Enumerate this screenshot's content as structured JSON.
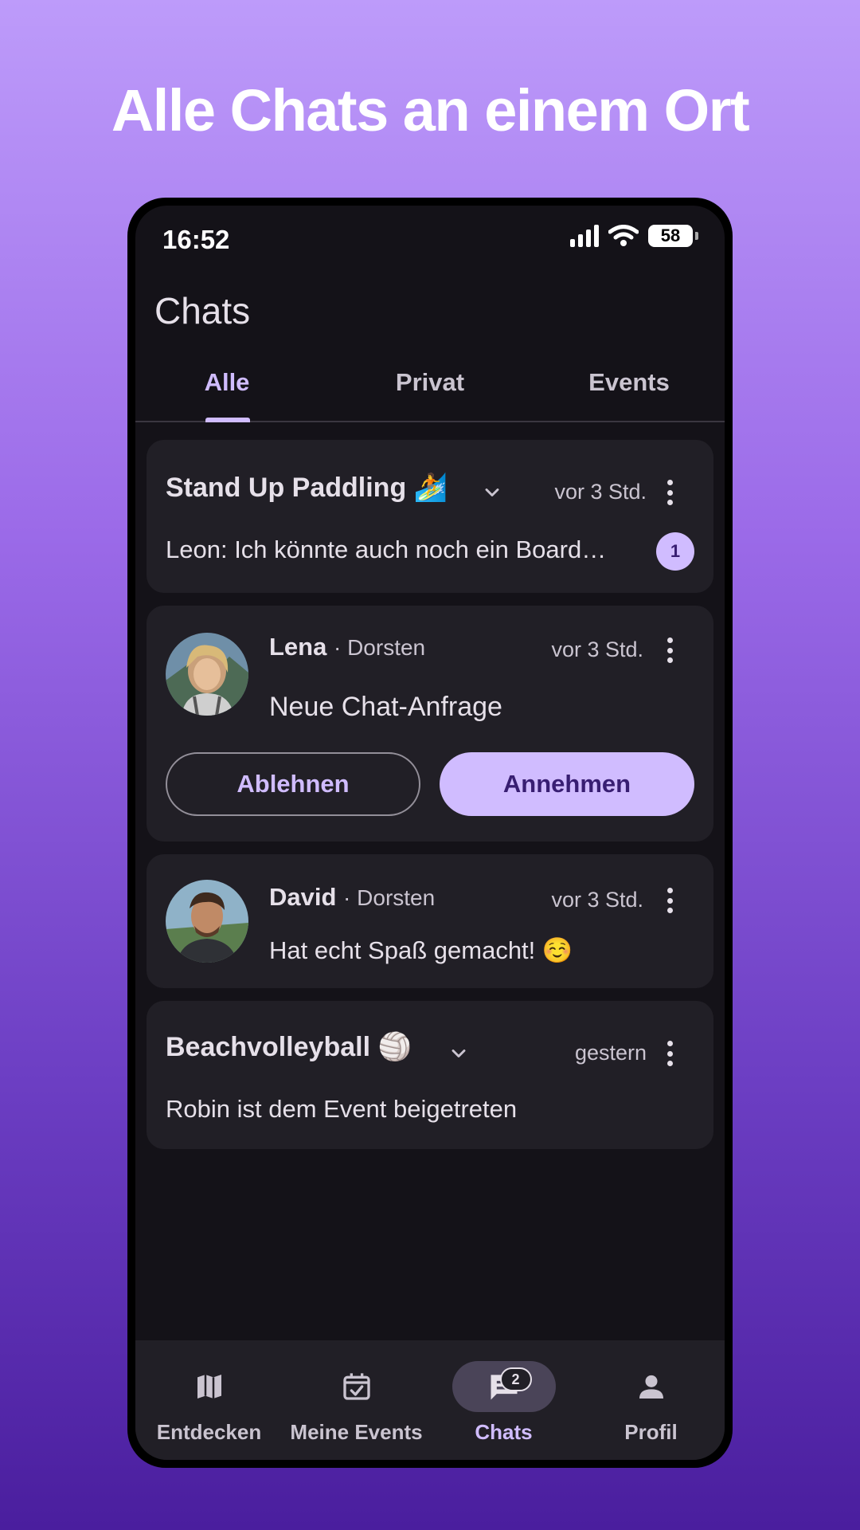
{
  "headline": "Alle Chats an einem Ort",
  "status": {
    "time": "16:52",
    "battery": "58"
  },
  "app_title": "Chats",
  "tabs": [
    {
      "label": "Alle",
      "active": true
    },
    {
      "label": "Privat",
      "active": false
    },
    {
      "label": "Events",
      "active": false
    }
  ],
  "chats": {
    "sup": {
      "title": "Stand Up Paddling",
      "emoji": "🏄",
      "time": "vor 3 Std.",
      "message": "Leon: Ich könnte auch noch ein Board…",
      "unread": "1"
    },
    "lena": {
      "name": "Lena",
      "location": "· Dorsten",
      "time": "vor 3 Std.",
      "message": "Neue Chat-Anfrage",
      "decline": "Ablehnen",
      "accept": "Annehmen"
    },
    "david": {
      "name": "David",
      "location": "· Dorsten",
      "time": "vor 3 Std.",
      "message": "Hat echt Spaß gemacht! ☺️"
    },
    "beach": {
      "title": "Beachvolleyball",
      "emoji": "🏐",
      "time": "gestern",
      "message": "Robin ist dem Event beigetreten"
    }
  },
  "nav": [
    {
      "label": "Entdecken",
      "icon": "map-icon"
    },
    {
      "label": "Meine Events",
      "icon": "calendar-check-icon"
    },
    {
      "label": "Chats",
      "icon": "chat-icon",
      "badge": "2",
      "active": true
    },
    {
      "label": "Profil",
      "icon": "person-icon"
    }
  ],
  "colors": {
    "accent": "#d0bcff",
    "surface": "#211f26",
    "background": "#141218"
  }
}
